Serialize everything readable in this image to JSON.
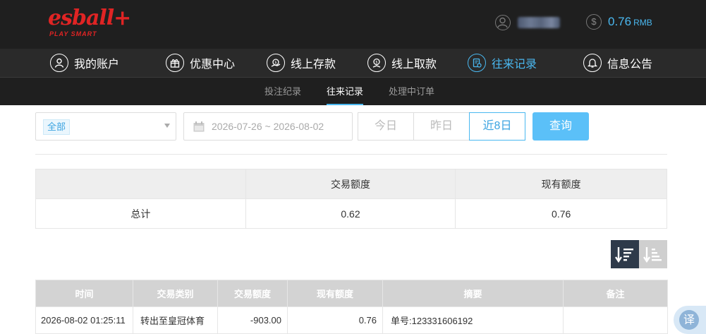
{
  "brand": {
    "name": "esball+",
    "tagline": "PLAY SMART"
  },
  "header": {
    "balance_value": "0.76",
    "balance_unit": "RMB"
  },
  "nav": {
    "items": [
      {
        "label": "我的账户",
        "icon": "user-icon"
      },
      {
        "label": "优惠中心",
        "icon": "gift-icon"
      },
      {
        "label": "线上存款",
        "icon": "deposit-icon"
      },
      {
        "label": "线上取款",
        "icon": "withdraw-icon"
      },
      {
        "label": "往来记录",
        "icon": "records-icon",
        "active": true
      },
      {
        "label": "信息公告",
        "icon": "bell-icon"
      }
    ]
  },
  "subnav": {
    "items": [
      {
        "label": "投注纪录"
      },
      {
        "label": "往来记录",
        "active": true
      },
      {
        "label": "处理中订单"
      }
    ]
  },
  "filters": {
    "type_selected": "全部",
    "date_range": "2026-07-26 ~ 2026-08-02",
    "quick": [
      "今日",
      "昨日",
      "近8日"
    ],
    "quick_active": "近8日",
    "query_label": "查询"
  },
  "summary": {
    "headers": [
      "",
      "交易额度",
      "现有额度"
    ],
    "row": {
      "label": "总计",
      "amount": "0.62",
      "balance": "0.76"
    }
  },
  "records": {
    "headers": [
      "时间",
      "交易类别",
      "交易额度",
      "现有额度",
      "摘要",
      "备注"
    ],
    "rows": [
      {
        "time": "2026-08-02 01:25:11",
        "type": "转出至皇冠体育",
        "amount": "-903.00",
        "balance": "0.76",
        "summary": "单号:123331606192",
        "note": ""
      }
    ]
  },
  "translate_label": "译",
  "colors": {
    "accent": "#4ab8f0",
    "brand": "#e02424",
    "header_bg": "#1f1f1f",
    "nav_bg": "#2a2a2a"
  }
}
